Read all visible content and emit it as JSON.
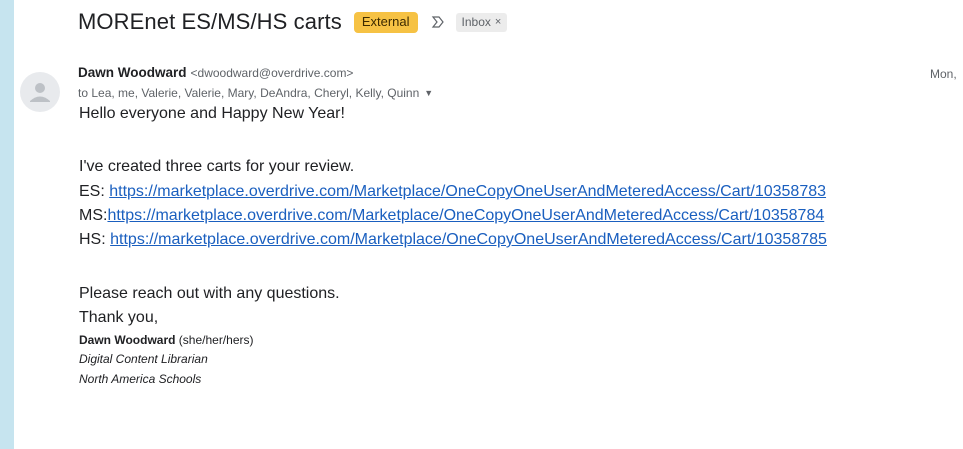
{
  "email": {
    "subject": "MOREnet ES/MS/HS carts",
    "labels": {
      "external": "External",
      "inbox": "Inbox",
      "inbox_close": "×"
    },
    "sender": {
      "name": "Dawn Woodward",
      "email": "<dwoodward@overdrive.com>"
    },
    "date": "Mon,",
    "recipients": "to Lea, me, Valerie, Valerie, Mary, DeAndra, Cheryl, Kelly, Quinn",
    "body": {
      "greeting": "Hello everyone and Happy New Year!",
      "intro": "I've created three carts for your review.",
      "carts": [
        {
          "prefix": "ES: ",
          "url": "https://marketplace.overdrive.com/Marketplace/OneCopyOneUserAndMeteredAccess/Cart/10358783"
        },
        {
          "prefix": "MS:",
          "url": "https://marketplace.overdrive.com/Marketplace/OneCopyOneUserAndMeteredAccess/Cart/10358784"
        },
        {
          "prefix": "HS: ",
          "url": "https://marketplace.overdrive.com/Marketplace/OneCopyOneUserAndMeteredAccess/Cart/10358785"
        }
      ],
      "closing": "Please reach out with any questions.",
      "thanks": "Thank you,"
    },
    "signature": {
      "name": "Dawn Woodward",
      "pronouns": " (she/her/hers)",
      "title": "Digital Content Librarian",
      "org": "North America Schools"
    }
  },
  "icons": {
    "importance": "importance-marker-icon",
    "avatar": "default-avatar-icon",
    "dropdown": "chevron-down-icon"
  },
  "colors": {
    "background": "#c6e4ef",
    "external_label": "#f6c244",
    "link": "#1a5fbf"
  }
}
